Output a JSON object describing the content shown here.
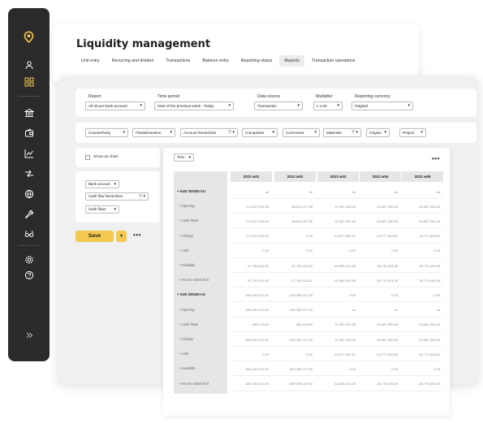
{
  "page": {
    "title": "Liquidity management",
    "tabs": [
      "Unit entry",
      "Recurring and divided",
      "Transactions",
      "Balance entry",
      "Reporting status",
      "Reports",
      "Transaction operations"
    ],
    "active_tab": "Reports"
  },
  "sidebar": {
    "icons": [
      "logo-pin-icon",
      "user-icon",
      "grid-icon",
      "bank-icon",
      "wallet-icon",
      "chart-icon",
      "transfer-icon",
      "globe-icon",
      "wrench-icon",
      "glasses-icon",
      "gear-icon",
      "help-icon",
      "expand-icon"
    ],
    "active_color": "#f3c94f"
  },
  "params": {
    "report_label": "Report",
    "report_value": "All ok per bank account",
    "period_label": "Time period",
    "period_value": "Start of the previous week - Today",
    "source_label": "Data source",
    "source_value": "Transaction",
    "multiplier_label": "Multiplier",
    "multiplier_value": "x 1,00",
    "currency_label": "Reporting currency",
    "currency_value": "Original"
  },
  "filters": [
    "CounterParty",
    "FlowDimension",
    "Account hierarchies",
    "Companies",
    "Currencies",
    "Materials",
    "Origins",
    "Project"
  ],
  "show_as_chart": "Show as chart",
  "grouping": [
    "Bank account",
    "Cash flow hierarchies",
    "Cash flows"
  ],
  "save_label": "Save",
  "time_label": "Time",
  "columns": [
    "2023 w01",
    "2023 w02",
    "2023 w03",
    "2023 w04",
    "2023 w05"
  ],
  "rows": [
    {
      "label": "+ AUD 320435 AU",
      "main": true,
      "values": [
        "ok",
        "ok",
        "ok",
        "ok",
        "ok"
      ]
    },
    {
      "label": "+ Opening",
      "main": false,
      "values": [
        "174,407,225.33",
        "66,624,237.38",
        "37,667,225.33",
        "53,687,330.55",
        "53,687,335.18"
      ]
    },
    {
      "label": "+ Cash flows",
      "main": false,
      "values": [
        "174,407,225.64",
        "66,624,237.38",
        "37,667,225.33",
        "53,687,330.55",
        "53,687,335.18"
      ]
    },
    {
      "label": "+ Closing",
      "main": false,
      "values": [
        "174,407,225.33",
        "0.00",
        "-14,877,825.41",
        "-15,777,816.62",
        "-16,777,810.62"
      ]
    },
    {
      "label": "+ Limit",
      "main": false,
      "values": [
        "0.00",
        "0.00",
        "0.00",
        "0.00",
        "0.00"
      ]
    },
    {
      "label": "+ Available",
      "main": false,
      "values": [
        "-47,750,414.82",
        "-47,750,414.82",
        "-46,880,414.88",
        "-38,770,434.08",
        "-38,770,424.08"
      ]
    },
    {
      "label": "+ Are we under limit",
      "main": false,
      "values": [
        "-47,750,414.82",
        "-47,750,414.82",
        "-42,880,414.88",
        "-38,770,424.08",
        "-38,770,424.08"
      ]
    },
    {
      "label": "+ AUD 320435 AU",
      "main": true,
      "values": [
        "-650 462 012,00",
        "-628 356 127,00",
        "0.00",
        "0.00",
        "0.00"
      ]
    },
    {
      "label": "+ Opening",
      "main": false,
      "values": [
        "-650 462 012,00",
        "-639 356 127,00",
        "ok",
        "ok",
        "ok"
      ]
    },
    {
      "label": "+ Cash flows",
      "main": false,
      "values": [
        "-389 123,00",
        "-460 213,99",
        "37,667,225.33",
        "53,687,330.55",
        "53,687,335.18"
      ]
    },
    {
      "label": "+ Closing",
      "main": false,
      "values": [
        "-650 462 012,00",
        "-639 356 127,00",
        "37,667,225.33",
        "53,687,330.55",
        "53,687,330.55"
      ]
    },
    {
      "label": "+ Limit",
      "main": false,
      "values": [
        "0.00",
        "0.00",
        "-14,877,825.41",
        "-15,777,816.62",
        "-15,777,816.62"
      ]
    },
    {
      "label": "+ Available",
      "main": false,
      "values": [
        "-650 462 012,00",
        "-603 356 127,00",
        "0.00",
        "0.00",
        "0.00"
      ]
    },
    {
      "label": "+ Are we under limit",
      "main": false,
      "values": [
        "-650 462 012,00",
        "-699 356 127,00",
        "-42,880,424.08",
        "-38,770,424.08",
        "-38,770,424.08"
      ]
    }
  ]
}
